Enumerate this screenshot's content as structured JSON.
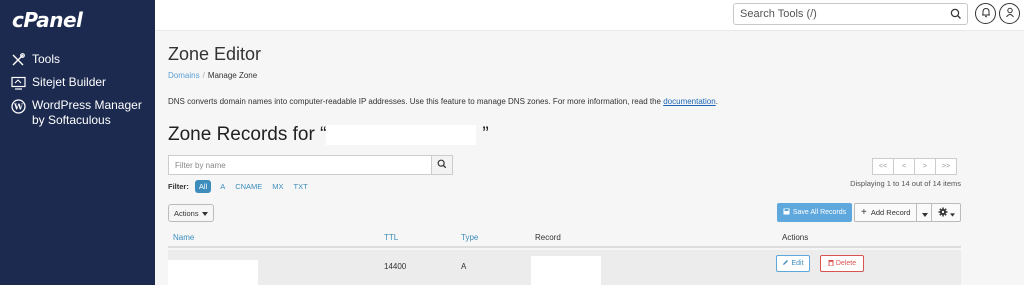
{
  "sidebar": {
    "logo": "cPanel",
    "items": [
      {
        "label": "Tools",
        "icon": "tools-icon"
      },
      {
        "label": "Sitejet Builder",
        "icon": "sitejet-icon"
      },
      {
        "label": "WordPress Manager by Softaculous",
        "icon": "wordpress-icon"
      }
    ]
  },
  "header": {
    "search_placeholder": "Search Tools (/)",
    "icons": [
      "search-icon",
      "bell-icon",
      "user-icon"
    ]
  },
  "main": {
    "title": "Zone Editor",
    "breadcrumb": {
      "domains": "Domains",
      "separator": "/",
      "current": "Manage Zone"
    },
    "intro_text": "DNS converts domain names into computer-readable IP addresses. Use this feature to manage DNS zones. For more information, read the",
    "intro_link": "documentation",
    "intro_end": ".",
    "section_title_prefix": "Zone Records for “",
    "section_title_suffix": "”",
    "filter_placeholder": "Filter by name",
    "filter_label": "Filter:",
    "filter_types": [
      "All",
      "A",
      "CNAME",
      "MX",
      "TXT"
    ],
    "active_filter": "All",
    "pager": [
      "<<",
      "<",
      ">",
      ">>"
    ],
    "pager_info": "Displaying 1 to 14 out of 14 items",
    "actions_label": "Actions",
    "save_all_label": "Save All Records",
    "add_record_label": "Add Record",
    "table": {
      "columns": [
        "Name",
        "TTL",
        "Type",
        "Record",
        "Actions"
      ],
      "rows": [
        {
          "ttl": "14400",
          "type": "A",
          "edit": "Edit",
          "delete": "Delete"
        }
      ]
    }
  },
  "colors": {
    "sidebar_bg": "#1c2a4f",
    "link_blue": "#3c8dbc",
    "primary_button": "#5fa8dd",
    "danger": "#d9534f"
  }
}
